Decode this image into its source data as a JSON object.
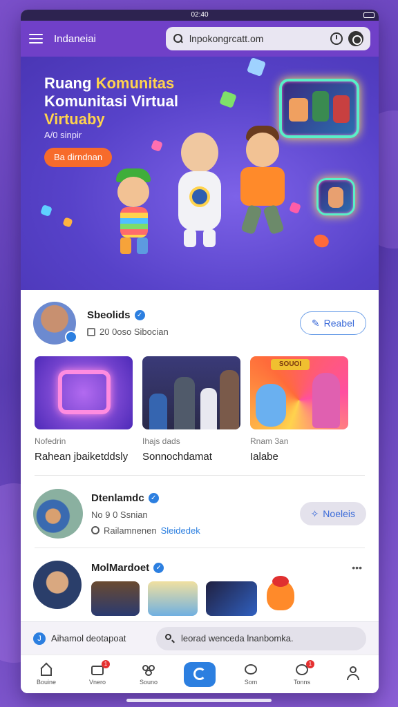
{
  "status": {
    "time": "02:40"
  },
  "topbar": {
    "brand": "Indaneiai",
    "search_query": "lnpokongrcatt.om"
  },
  "hero": {
    "title_line1a": "Ruang ",
    "title_line1b": "Komunitas",
    "title_line2": "Komunitasi Virtual",
    "title_line3": "Virtuaby",
    "subtitle": "A/0 sinpir",
    "cta": "Ba dirndnan"
  },
  "profile": {
    "name": "Sbeolids",
    "meta": "20 0oso Sibocian",
    "action": "Reabel"
  },
  "cards": [
    {
      "small": "Nofedrin",
      "title": "Rahean jbaiketddsly"
    },
    {
      "small": "Ihajs dads",
      "title": "Sonnochdamat"
    },
    {
      "small": "Rnam 3an",
      "title": "Ialabe"
    }
  ],
  "card3_sign": "SOUOI",
  "row2": {
    "name": "Dtenlamdc",
    "line1": "No 9 0 Ssnian",
    "line2a": "Railamnenen ",
    "line2b": "Sleidedek",
    "action": "Noeleis"
  },
  "row3": {
    "name": "MolMardoet",
    "more": "•••"
  },
  "bottom_search": {
    "icon": "J",
    "label": "Aihamol deotapoat",
    "query": "leorad wenceda lnanbomka."
  },
  "tabs": [
    {
      "label": "Bouine"
    },
    {
      "label": "Vnero",
      "badge": "1"
    },
    {
      "label": "Souno"
    },
    {
      "label": ""
    },
    {
      "label": "Som"
    },
    {
      "label": "Tonns",
      "badge": "1"
    },
    {
      "label": ""
    }
  ],
  "colors": {
    "accent": "#7040c8",
    "primary_blue": "#2c7fe0",
    "cta_orange": "#f76b2b",
    "check_blue": "#2c7fe0"
  }
}
